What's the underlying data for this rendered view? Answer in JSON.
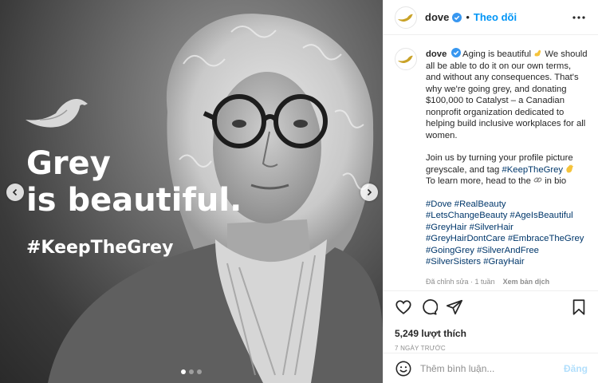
{
  "media": {
    "headline_line1": "Grey",
    "headline_line2": "is beautiful.",
    "hashtag": "#KeepTheGrey",
    "slide_count": 3,
    "active_slide": 1,
    "icons": [
      "dove-logo-icon",
      "chevron-left-icon",
      "chevron-right-icon"
    ]
  },
  "header": {
    "username": "dove",
    "separator": "•",
    "follow_label": "Theo dõi",
    "icons": [
      "dove-avatar-icon",
      "verified-badge-icon",
      "more-options-icon"
    ]
  },
  "caption": {
    "username": "dove",
    "p1": "Aging is beautiful",
    "p1b": " We should all be able to do it on our own terms, and without any consequences. That's why we're going grey, and donating $100,000 to Catalyst – a Canadian nonprofit organization dedicated to helping build inclusive workplaces for all women.",
    "p2a": "Join us by turning your profile picture greyscale, and tag ",
    "p2_tag": "#KeepTheGrey",
    "p2b": "To learn more, head to the",
    "p2c": " in bio",
    "hashtags": [
      "#Dove",
      "#RealBeauty",
      "#LetsChangeBeauty",
      "#AgeIsBeautiful",
      "#GreyHair",
      "#SilverHair",
      "#GreyHairDontCare",
      "#EmbraceTheGrey",
      "#GoingGrey",
      "#SilverAndFree",
      "#SilverSisters",
      "#GrayHair"
    ],
    "edited": "Đã chỉnh sửa · 1 tuần",
    "translate": "Xem bản dịch"
  },
  "actions": {
    "likes": "5,249 lượt thích",
    "posted": "7 NGÀY TRƯỚC",
    "icons": [
      "heart-icon",
      "comment-icon",
      "share-icon",
      "bookmark-icon"
    ]
  },
  "comment": {
    "placeholder": "Thêm bình luận...",
    "post_label": "Đăng"
  },
  "colors": {
    "accent": "#0095f6",
    "link": "#00376b",
    "muted": "#8e8e8e",
    "post_disabled": "#b2dffc"
  }
}
